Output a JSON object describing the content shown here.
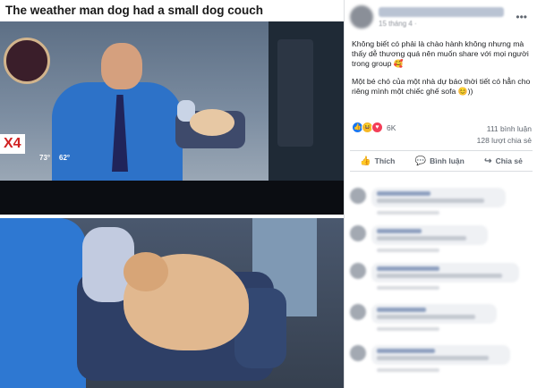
{
  "photo": {
    "title": "The weather man dog had a small dog couch",
    "channel_badge": "X4",
    "temp_left": "73°",
    "temp_right": "62°"
  },
  "post": {
    "timestamp": "15 tháng 4 ·",
    "caption_paragraphs": [
      "Không biết có phải là chào hành không nhưng mà thấy dễ thương quá nên muốn share với mọi người trong group 🥰",
      "Một bé chó của một nhà dự báo thời tiết có hẳn cho riêng mình một chiếc ghế sofa 😊))"
    ],
    "reaction_count": "6K",
    "comment_count": "111 bình luận",
    "share_count": "128 lượt chia sẻ",
    "actions": {
      "like": "Thích",
      "comment": "Bình luận",
      "share": "Chia sẻ"
    }
  },
  "icons": {
    "like": "thumbs-up-icon",
    "comment": "comment-icon",
    "share": "share-icon",
    "more": "more-icon"
  },
  "colors": {
    "facebook_blue": "#1877f2",
    "haha_yellow": "#f7b928",
    "love_red": "#f33e58"
  }
}
